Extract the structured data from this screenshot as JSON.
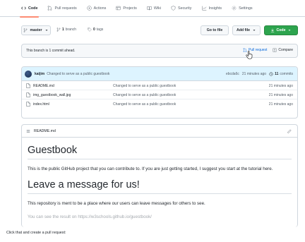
{
  "repo_tabs": [
    {
      "label": "Code",
      "icon": "code-icon",
      "active": true
    },
    {
      "label": "Pull requests",
      "icon": "pull-request-icon"
    },
    {
      "label": "Actions",
      "icon": "play-icon"
    },
    {
      "label": "Projects",
      "icon": "table-icon"
    },
    {
      "label": "Wiki",
      "icon": "book-icon"
    },
    {
      "label": "Security",
      "icon": "shield-icon"
    },
    {
      "label": "Insights",
      "icon": "graph-icon"
    },
    {
      "label": "Settings",
      "icon": "gear-icon"
    }
  ],
  "branchbar": {
    "branch": "master",
    "branches_count": "1",
    "branches_label": "branch",
    "tags_count": "0",
    "tags_label": "tags",
    "go_to_file": "Go to file",
    "add_file": "Add file",
    "code": "Code"
  },
  "ahead": {
    "text": "This branch is 1 commit ahead.",
    "pull_request": "Pull request",
    "compare": "Compare"
  },
  "latest_commit": {
    "author": "kaijim",
    "message": "Changed to serve as a public guestbook",
    "sha": "ebcda6c",
    "age": "21 minutes ago",
    "commits_count": "11",
    "commits_label": "commits"
  },
  "files": [
    {
      "name": "README.md",
      "message": "Changed to serve as a public guestbook",
      "age": "21 minutes ago"
    },
    {
      "name": "img_guestbook_wall.jpg",
      "message": "Changed to serve as a public guestbook",
      "age": "21 minutes ago"
    },
    {
      "name": "index.html",
      "message": "Changed to serve as a public guestbook",
      "age": "21 minutes ago"
    }
  ],
  "readme": {
    "filename": "README.md",
    "h1": "Guestbook",
    "p1": "This is the public GitHub project that you can contribute to. If you are just getting started, I suggest you start at the tutorial here.",
    "h2": "Leave a message for us!",
    "p2": "This repository is ment to be a place where our users can leave messages for others to see.",
    "p3": "You can see the result on https://w3schools.github.io/guestbook/"
  },
  "caption": "Click that and create a pull request:",
  "colors": {
    "accent": "#0969da",
    "green": "#2da44e",
    "active_tab": "#fd8c73"
  }
}
